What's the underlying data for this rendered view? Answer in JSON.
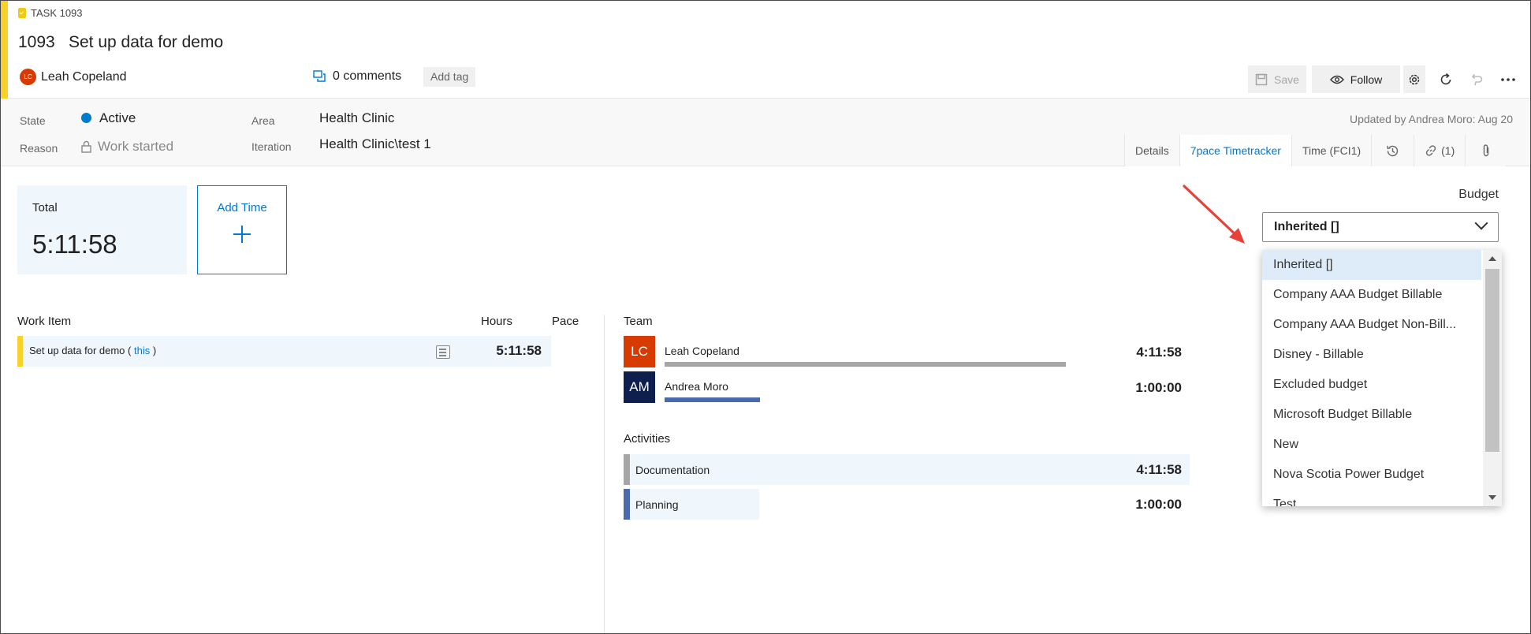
{
  "header": {
    "task_type": "TASK 1093",
    "id": "1093",
    "title": "Set up data for demo",
    "assignee_initials": "LC",
    "assignee": "Leah Copeland",
    "comments": "0 comments",
    "add_tag": "Add tag",
    "save_label": "Save",
    "follow_label": "Follow"
  },
  "fields": {
    "state_label": "State",
    "state_value": "Active",
    "reason_label": "Reason",
    "reason_value": "Work started",
    "area_label": "Area",
    "area_value": "Health Clinic",
    "iteration_label": "Iteration",
    "iteration_value": "Health Clinic\\test 1",
    "updated": "Updated by Andrea Moro: Aug 20"
  },
  "tabs": [
    {
      "label": "Details"
    },
    {
      "label": "7pace Timetracker"
    },
    {
      "label": "Time (FCI1)"
    },
    {
      "label": ""
    },
    {
      "label": "(1)"
    },
    {
      "label": ""
    }
  ],
  "summary": {
    "total_label": "Total",
    "total_value": "5:11:58",
    "add_time_label": "Add Time"
  },
  "work_items": {
    "col_work_item": "Work Item",
    "col_hours": "Hours",
    "col_pace": "Pace",
    "rows": [
      {
        "title": "Set up data for demo",
        "open_paren": "(",
        "link": "this",
        "close_paren": ")",
        "hours": "5:11:58"
      }
    ]
  },
  "team": {
    "heading": "Team",
    "members": [
      {
        "initials": "LC",
        "name": "Leah Copeland",
        "time": "4:11:58",
        "share": 0.808,
        "color": "#d83b01",
        "bar_color": "#a6a6a6"
      },
      {
        "initials": "AM",
        "name": "Andrea Moro",
        "time": "1:00:00",
        "share": 0.192,
        "color": "#0f1f4d",
        "bar_color": "#4a6aab"
      }
    ]
  },
  "activities": {
    "heading": "Activities",
    "items": [
      {
        "name": "Documentation",
        "time": "4:11:58",
        "share": 1.0,
        "bar_color": "#a6a6a6"
      },
      {
        "name": "Planning",
        "time": "1:00:00",
        "share": 0.24,
        "bar_color": "#4a6aab"
      }
    ]
  },
  "budget": {
    "label": "Budget",
    "selected": "Inherited []",
    "options": [
      "Inherited []",
      "Company AAA Budget Billable",
      "Company AAA Budget Non-Bill...",
      "Disney - Billable",
      "Excluded budget",
      "Microsoft Budget Billable",
      "New",
      "Nova Scotia Power Budget",
      "Test"
    ]
  },
  "colors": {
    "accent": "#0078d4",
    "task_yellow": "#f8d22a",
    "state_active": "#007acc",
    "annotation_arrow": "#e8413a"
  }
}
